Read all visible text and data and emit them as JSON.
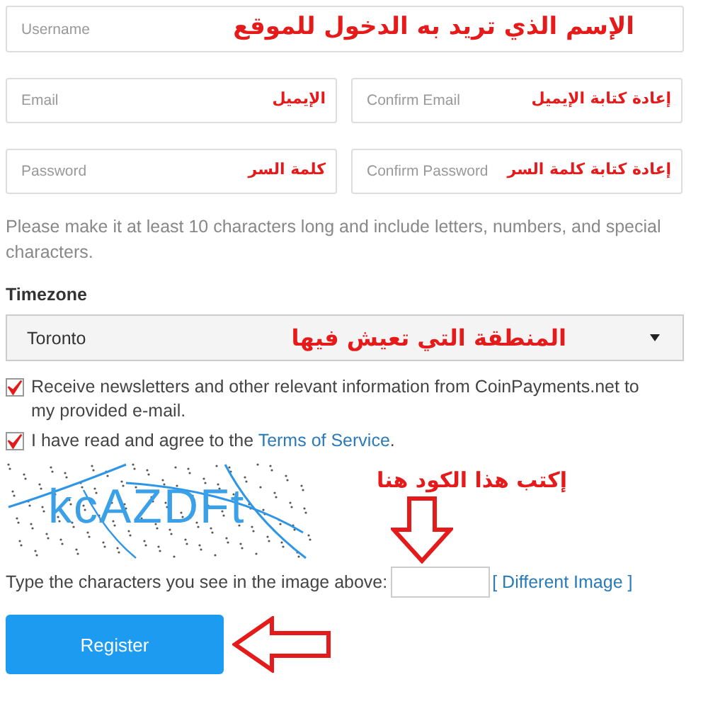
{
  "username": {
    "placeholder": "Username"
  },
  "email_row": [
    {
      "placeholder": "Email"
    },
    {
      "placeholder": "Confirm Email"
    }
  ],
  "password_row": [
    {
      "placeholder": "Password"
    },
    {
      "placeholder": "Confirm Password"
    }
  ],
  "annotations": {
    "username": "الإسم الذي تريد به الدخول للموقع",
    "email": "الإيميل",
    "confirm_email": "إعادة كتابة الإيميل",
    "password": "كلمة السر",
    "confirm_password": "إعادة كتابة كلمة السر",
    "timezone": "المنطقة التي تعيش فيها",
    "captcha": "إكتب هذا الكود هنا"
  },
  "hint": "Please make it at least 10 characters long and include letters, numbers, and special characters.",
  "timezone": {
    "label": "Timezone",
    "value": "Toronto"
  },
  "checkboxes": [
    {
      "text": "Receive newsletters and other relevant information from CoinPayments.net to my provided e-mail.",
      "checked": true
    },
    {
      "text": "I have read and agree to the ",
      "link": "Terms of Service",
      "after": ".",
      "checked": true
    }
  ],
  "captcha": {
    "image_text": "kcAZDFt",
    "prompt": "Type the characters you see in the image above:",
    "link": "[ Different Image ]"
  },
  "register_button": "Register"
}
